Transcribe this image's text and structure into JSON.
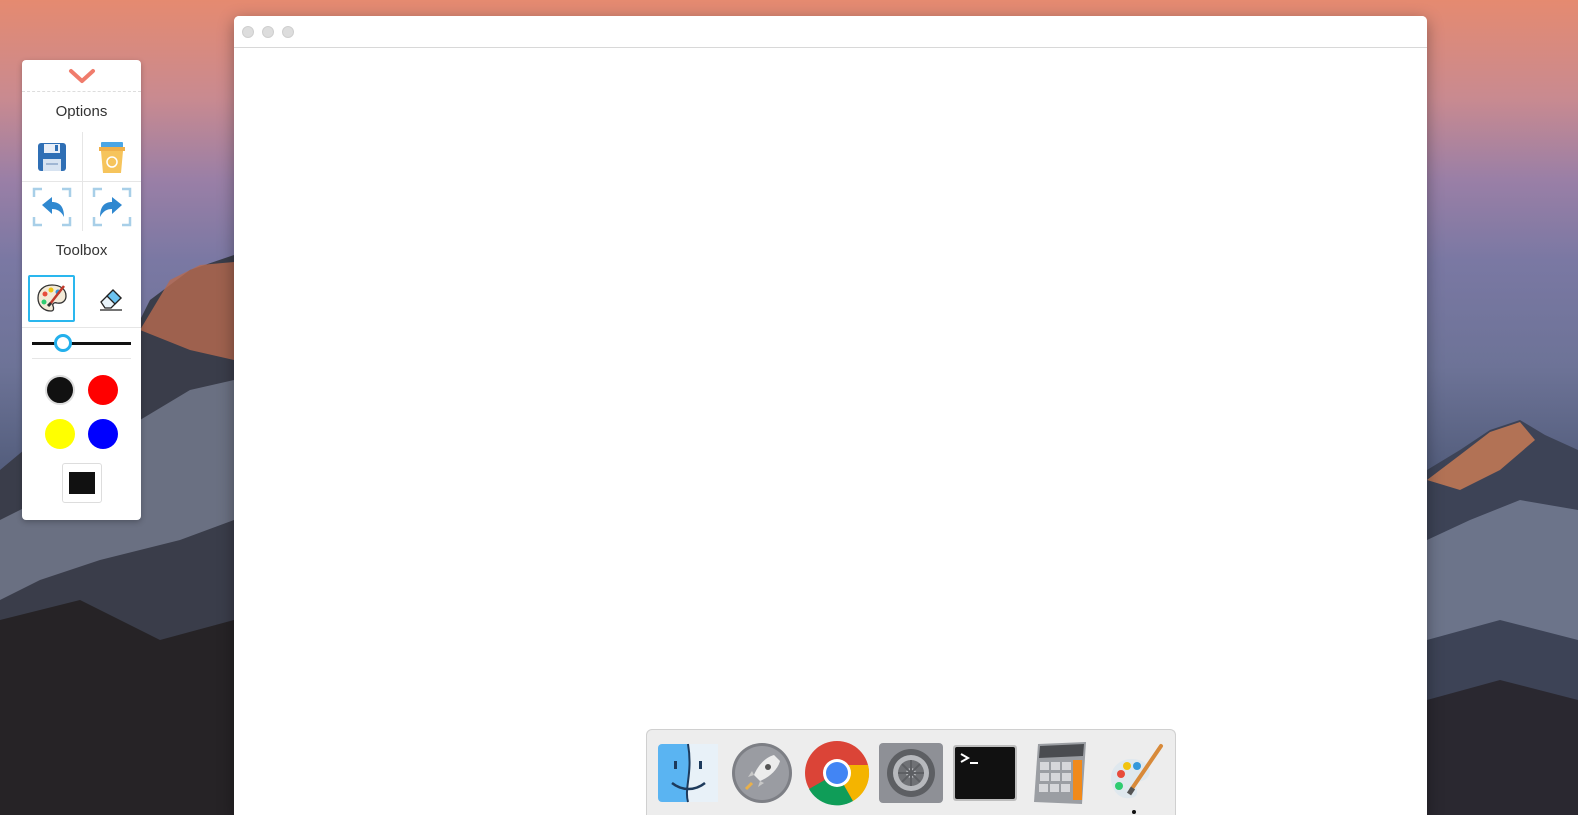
{
  "panel": {
    "options_title": "Options",
    "toolbox_title": "Toolbox",
    "options": [
      {
        "name": "save",
        "icon": "floppy-disk-icon"
      },
      {
        "name": "clear",
        "icon": "trash-bin-icon"
      },
      {
        "name": "undo",
        "icon": "undo-arrow-icon"
      },
      {
        "name": "redo",
        "icon": "redo-arrow-icon"
      }
    ],
    "tools": [
      {
        "name": "brush",
        "icon": "palette-brush-icon",
        "active": true
      },
      {
        "name": "eraser",
        "icon": "eraser-icon",
        "active": false
      }
    ],
    "brush_size_fraction": 0.27,
    "colors": [
      "#111111",
      "#ff0000",
      "#ffff00",
      "#0000ff"
    ],
    "selected_color": "#111111"
  },
  "window": {
    "traffic_lights": [
      "close",
      "minimize",
      "zoom"
    ]
  },
  "dock": {
    "apps": [
      {
        "name": "finder",
        "icon": "finder-icon"
      },
      {
        "name": "launchpad",
        "icon": "rocket-icon"
      },
      {
        "name": "chrome",
        "icon": "chrome-icon"
      },
      {
        "name": "system-preferences",
        "icon": "gear-icon"
      },
      {
        "name": "terminal",
        "icon": "terminal-icon"
      },
      {
        "name": "calculator",
        "icon": "calculator-icon"
      },
      {
        "name": "paint",
        "icon": "paint-palette-icon",
        "running": true
      }
    ]
  }
}
